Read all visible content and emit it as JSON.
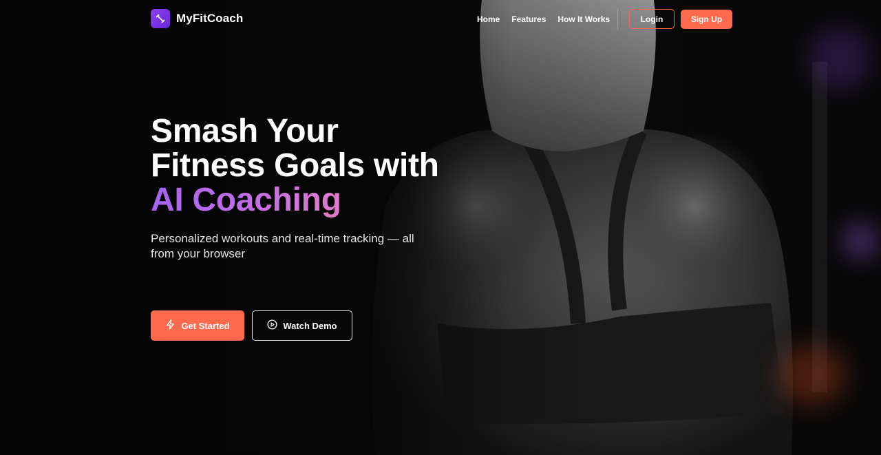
{
  "brand": {
    "name": "MyFitCoach",
    "logo_icon": "dumbbell-icon",
    "logo_color": "#7b33e6"
  },
  "nav": {
    "links": [
      "Home",
      "Features",
      "How It Works"
    ],
    "login_label": "Login",
    "signup_label": "Sign Up"
  },
  "hero": {
    "headline_part1": "Smash Your Fitness Goals with",
    "headline_accent": "AI Coaching",
    "subheadline": "Personalized workouts and real-time tracking — all from your browser",
    "primary_cta": {
      "label": "Get Started",
      "icon": "lightning-icon"
    },
    "secondary_cta": {
      "label": "Watch Demo",
      "icon": "play-circle-icon"
    },
    "background_image": "woman-back-workout-photo"
  },
  "colors": {
    "accent_orange": "#ff6a4d",
    "accent_purple": "#a463f2",
    "accent_pink": "#e27bc9",
    "background": "#070707"
  }
}
